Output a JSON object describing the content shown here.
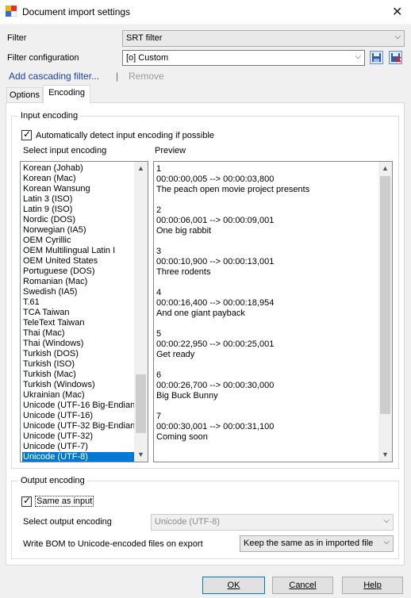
{
  "window": {
    "title": "Document import settings",
    "close_icon": "close-icon"
  },
  "filter": {
    "label": "Filter",
    "value": "SRT filter"
  },
  "filter_config": {
    "label": "Filter configuration",
    "value": "[o] Custom"
  },
  "actions": {
    "add_cascading": "Add cascading filter...",
    "separator": "|",
    "remove": "Remove"
  },
  "tabs": [
    {
      "label": "Options"
    },
    {
      "label": "Encoding"
    }
  ],
  "input_group": {
    "title": "Input encoding",
    "auto_detect_label": "Automatically detect input encoding if possible",
    "auto_detect_checked": true,
    "select_label": "Select input encoding",
    "preview_label": "Preview"
  },
  "encodings": [
    "Korean (Johab)",
    "Korean (Mac)",
    "Korean Wansung",
    "Latin 3 (ISO)",
    "Latin 9 (ISO)",
    "Nordic (DOS)",
    "Norwegian (IA5)",
    "OEM Cyrillic",
    "OEM Multilingual Latin I",
    "OEM United States",
    "Portuguese (DOS)",
    "Romanian (Mac)",
    "Swedish (IA5)",
    "T.61",
    "TCA Taiwan",
    "TeleText Taiwan",
    "Thai (Mac)",
    "Thai (Windows)",
    "Turkish (DOS)",
    "Turkish (ISO)",
    "Turkish (Mac)",
    "Turkish (Windows)",
    "Ukrainian (Mac)",
    "Unicode (UTF-16 Big-Endian)",
    "Unicode (UTF-16)",
    "Unicode (UTF-32 Big-Endian)",
    "Unicode (UTF-32)",
    "Unicode (UTF-7)",
    "Unicode (UTF-8)"
  ],
  "selected_encoding": "Unicode (UTF-8)",
  "preview_lines": [
    "1",
    "00:00:00,005 --> 00:00:03,800",
    "The peach open movie project presents",
    "",
    "2",
    "00:00:06,001 --> 00:00:09,001",
    "One big rabbit",
    "",
    "3",
    "00:00:10,900 --> 00:00:13,001",
    "Three rodents",
    "",
    "4",
    "00:00:16,400 --> 00:00:18,954",
    "And one giant payback",
    "",
    "5",
    "00:00:22,950 --> 00:00:25,001",
    "Get ready",
    "",
    "6",
    "00:00:26,700 --> 00:00:30,000",
    "Big Buck Bunny",
    "",
    "7",
    "00:00:30,001 --> 00:00:31,100",
    "Coming soon"
  ],
  "output_group": {
    "title": "Output encoding",
    "same_as_input_label": "Same as input",
    "same_as_input_checked": true,
    "select_label": "Select output encoding",
    "select_value": "Unicode (UTF-8)",
    "bom_label": "Write BOM to Unicode-encoded files on export",
    "bom_value": "Keep the same as in imported file"
  },
  "buttons": {
    "ok": "OK",
    "cancel": "Cancel",
    "help": "Help"
  }
}
